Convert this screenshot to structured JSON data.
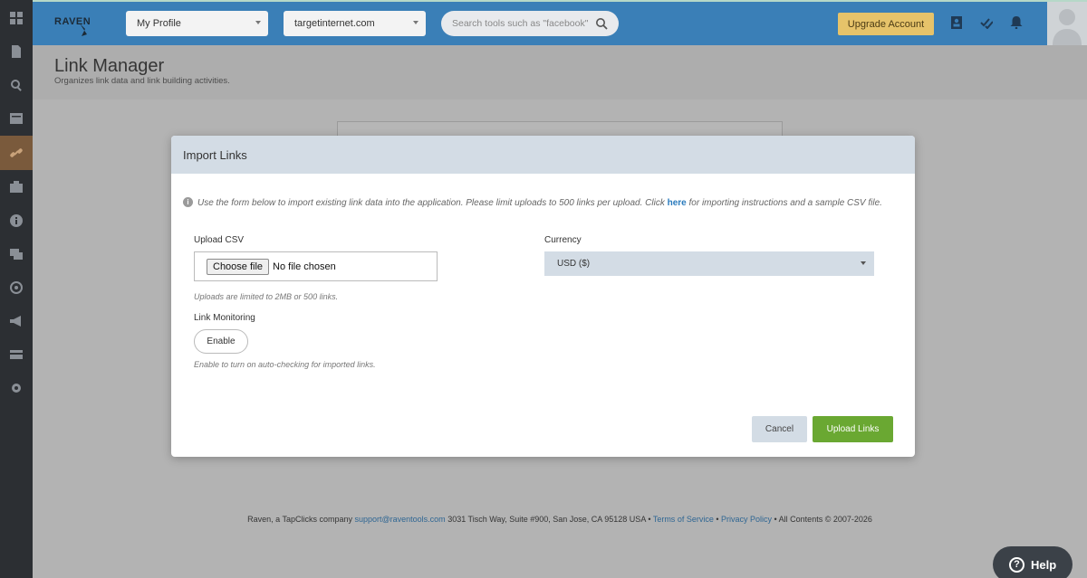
{
  "header": {
    "logo_text": "RAVEN",
    "profile_select": "My Profile",
    "site_select": "targetinternet.com",
    "search_placeholder": "Search tools such as \"facebook\"",
    "upgrade_label": "Upgrade Account"
  },
  "sidebar": {
    "items": [
      {
        "icon": "dashboard-icon"
      },
      {
        "icon": "document-icon"
      },
      {
        "icon": "search-icon"
      },
      {
        "icon": "report-icon"
      },
      {
        "icon": "link-icon",
        "active": true
      },
      {
        "icon": "briefcase-icon"
      },
      {
        "icon": "info-icon"
      },
      {
        "icon": "chat-icon"
      },
      {
        "icon": "target-icon"
      },
      {
        "icon": "megaphone-icon"
      },
      {
        "icon": "card-icon"
      },
      {
        "icon": "gear-icon"
      }
    ]
  },
  "page": {
    "title": "Link Manager",
    "subtitle": "Organizes link data and link building activities."
  },
  "modal": {
    "title": "Import Links",
    "info_text_before": "Use the form below to import existing link data into the application. Please limit uploads to 500 links per upload. Click ",
    "info_link": "here",
    "info_text_after": " for importing instructions and a sample CSV file.",
    "upload_label": "Upload CSV",
    "choose_file_label": "Choose file",
    "no_file_text": "No file chosen",
    "upload_hint": "Uploads are limited to 2MB or 500 links.",
    "monitoring_label": "Link Monitoring",
    "enable_label": "Enable",
    "monitoring_hint": "Enable to turn on auto-checking for imported links.",
    "currency_label": "Currency",
    "currency_value": "USD ($)",
    "cancel_label": "Cancel",
    "upload_button_label": "Upload Links"
  },
  "footer": {
    "company": "Raven, a TapClicks company ",
    "email": "support@raventools.com",
    "address": " 3031 Tisch Way, Suite #900, San Jose, CA 95128 USA • ",
    "terms": "Terms of Service",
    "sep": " • ",
    "privacy": "Privacy Policy",
    "rights": " • All Contents © 2007-2026"
  },
  "help": {
    "label": "Help"
  },
  "colors": {
    "topbar": "#3a7fb7",
    "sidebar": "#2c2f33",
    "upgrade": "#e6c36a",
    "primary_button": "#6aa832",
    "modal_header": "#d3dce5",
    "link": "#2a7bbd"
  }
}
